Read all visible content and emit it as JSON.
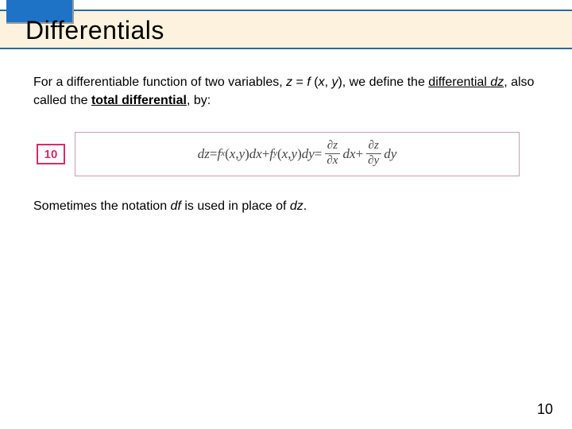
{
  "title": "Differentials",
  "intro": {
    "lead": "For a differentiable function of two variables, ",
    "eq_lhs": "z",
    "eq_mid": " = ",
    "eq_rhs_f": "f ",
    "eq_rhs_paren_open": "(",
    "eq_rhs_x": "x",
    "eq_rhs_comma": ", ",
    "eq_rhs_y": "y",
    "eq_rhs_paren_close": ")",
    "tail1": ", we define the ",
    "underline1_a": "differential ",
    "underline1_b": "dz",
    "tail2": ", also called the ",
    "underline2": "total differential",
    "tail3": ", by:"
  },
  "badge": "10",
  "formula": {
    "dz": "dz",
    "eq": " = ",
    "fx": "f",
    "sub_x": "x",
    "args_open": "(",
    "x": "x",
    "comma": ", ",
    "y": "y",
    "args_close": ") ",
    "dx": "dx",
    "plus": " + ",
    "fy": "f",
    "sub_y": "y",
    "dy": "dy",
    "eq2": " = ",
    "partial": "∂",
    "z": "z"
  },
  "note": {
    "pre": "Sometimes the notation ",
    "df": "df",
    "mid": " is used in place of ",
    "dz": "dz",
    "post": "."
  },
  "page": "10"
}
